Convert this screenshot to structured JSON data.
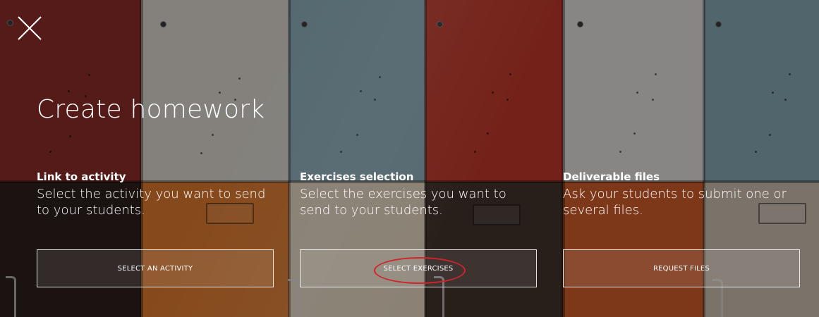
{
  "page": {
    "title": "Create homework",
    "close_icon": "close-icon"
  },
  "options": [
    {
      "title": "Link to activity",
      "description": "Select the activity you want to send to your students.",
      "button_label": "SELECT AN ACTIVITY"
    },
    {
      "title": "Exercises selection",
      "description": "Select the exercises you want to send to your students.",
      "button_label": "SELECT EXERCISES",
      "highlighted": true
    },
    {
      "title": "Deliverable files",
      "description": "Ask your students to submit one or several files.",
      "button_label": "REQUEST FILES"
    }
  ],
  "colors": {
    "text": "#ffffff",
    "highlight": "#d2232a"
  }
}
